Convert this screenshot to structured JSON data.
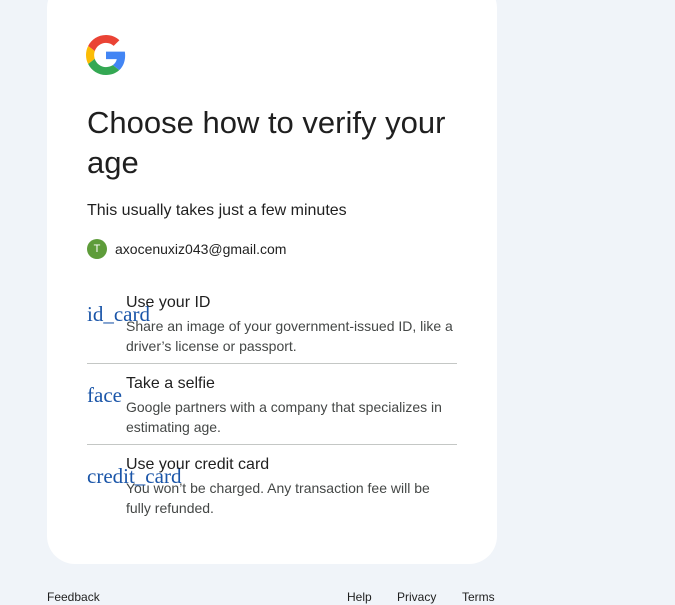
{
  "logo": {
    "icon": "google-g-icon",
    "colors": [
      "#4285F4",
      "#EA4335",
      "#FBBC05",
      "#34A853"
    ]
  },
  "title": "Choose how to verify your age",
  "subtitle": "This usually takes just a few minutes",
  "account": {
    "avatar_letter": "T",
    "avatar_color": "#5e9c3a",
    "email": "axocenuxiz043@gmail.com"
  },
  "options": [
    {
      "icon_fallback": "id_card",
      "label": "Use your ID",
      "description": "Share an image of your government-issued ID, like a driver’s license or passport."
    },
    {
      "icon_fallback": "face",
      "label": "Take a selfie",
      "description": "Google partners with a company that specializes in estimating age."
    },
    {
      "icon_fallback": "credit_card",
      "label": "Use your credit card",
      "description": "You won’t be charged. Any transaction fee will be fully refunded."
    }
  ],
  "footer": {
    "feedback": "Feedback",
    "help": "Help",
    "privacy": "Privacy",
    "terms": "Terms"
  }
}
